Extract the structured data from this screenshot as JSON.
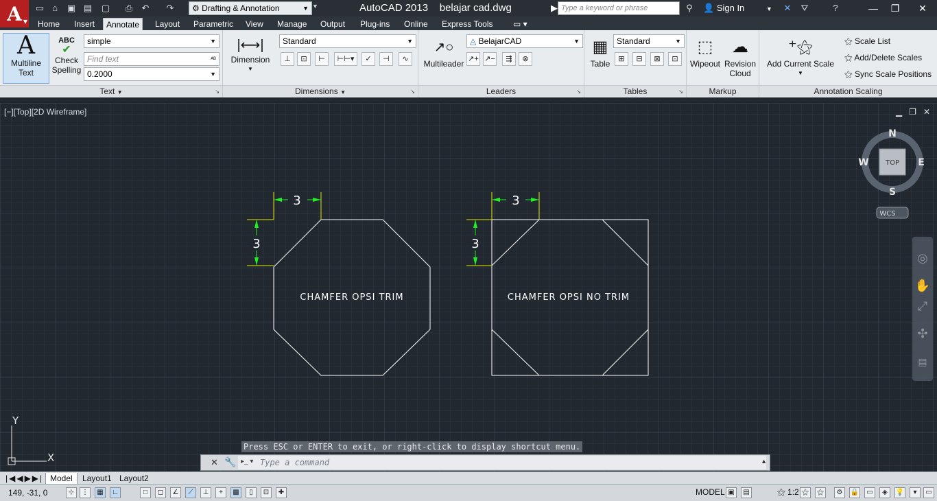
{
  "app": {
    "name": "AutoCAD 2013",
    "file": "belajar cad.dwg",
    "workspace": "Drafting & Annotation",
    "search_placeholder": "Type a keyword or phrase",
    "sign_in": "Sign In"
  },
  "ribbon_tabs": [
    "Home",
    "Insert",
    "Annotate",
    "Layout",
    "Parametric",
    "View",
    "Manage",
    "Output",
    "Plug-ins",
    "Online",
    "Express Tools"
  ],
  "active_tab": "Annotate",
  "panels": {
    "text": {
      "title": "Text",
      "multiline_label_1": "Multiline",
      "multiline_label_2": "Text",
      "check_label_1": "Check",
      "check_label_2": "Spelling",
      "abc": "ABC",
      "style": "simple",
      "find_placeholder": "Find text",
      "height": "0.2000"
    },
    "dimensions": {
      "title": "Dimensions",
      "dimension_label": "Dimension",
      "style": "Standard"
    },
    "leaders": {
      "title": "Leaders",
      "multileader_label": "Multileader",
      "style": "BelajarCAD"
    },
    "tables": {
      "title": "Tables",
      "table_label": "Table",
      "style": "Standard"
    },
    "markup": {
      "title": "Markup",
      "wipeout_label": "Wipeout",
      "revision_label_1": "Revision",
      "revision_label_2": "Cloud"
    },
    "annotation_scaling": {
      "title": "Annotation Scaling",
      "add_current_scale": "Add Current Scale",
      "scale_list": "Scale List",
      "add_delete_scales": "Add/Delete Scales",
      "sync_scale_positions": "Sync Scale Positions"
    }
  },
  "viewport": {
    "label": "[−][Top][2D Wireframe]",
    "compass": {
      "n": "N",
      "s": "S",
      "e": "E",
      "w": "W",
      "top": "TOP",
      "wcs": "WCS"
    },
    "ucs_x": "X",
    "ucs_y": "Y"
  },
  "drawing": {
    "left_text": "CHAMFER OPSI TRIM",
    "right_text": "CHAMFER OPSI NO TRIM",
    "dim_value": "3"
  },
  "command": {
    "hint": "Press ESC or ENTER to exit, or right-click to display shortcut menu.",
    "placeholder": "Type a command"
  },
  "layout_tabs": [
    "Model",
    "Layout1",
    "Layout2"
  ],
  "status": {
    "coords": "149, -31, 0",
    "model": "MODEL",
    "scale": "1:2"
  },
  "colors": {
    "background": "#212830",
    "accent_red": "#b51f1f",
    "dimension_green": "#22ee22",
    "dimension_yellow": "#e8e800",
    "geometry_white": "#ffffff"
  }
}
